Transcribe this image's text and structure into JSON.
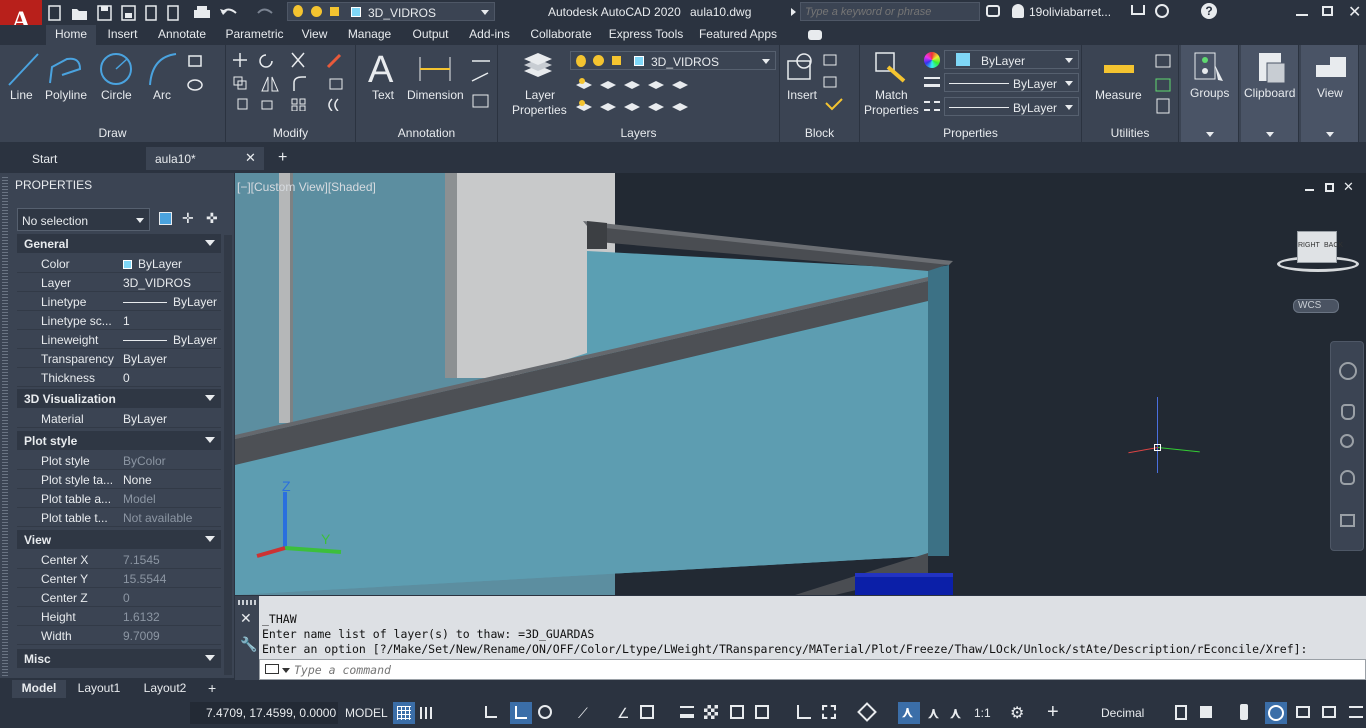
{
  "qat": {
    "app_title": "Autodesk AutoCAD 2020",
    "file_name": "aula10.dwg",
    "layer_current": "3D_VIDROS",
    "search_placeholder": "Type a keyword or phrase",
    "user": "19oliviabarret..."
  },
  "ribbon_tabs": [
    "Home",
    "Insert",
    "Annotate",
    "Parametric",
    "View",
    "Manage",
    "Output",
    "Add-ins",
    "Collaborate",
    "Express Tools",
    "Featured Apps"
  ],
  "ribbon": {
    "draw": {
      "title": "Draw",
      "line": "Line",
      "polyline": "Polyline",
      "circle": "Circle",
      "arc": "Arc"
    },
    "modify": {
      "title": "Modify"
    },
    "annotation": {
      "title": "Annotation",
      "text": "Text",
      "dimension": "Dimension"
    },
    "layers": {
      "title": "Layers",
      "layer_properties_1": "Layer",
      "layer_properties_2": "Properties",
      "current": "3D_VIDROS"
    },
    "block": {
      "title": "Block",
      "insert": "Insert"
    },
    "properties": {
      "title": "Properties",
      "match_1": "Match",
      "match_2": "Properties",
      "color": "ByLayer",
      "linetype": "ByLayer",
      "lineweight": "ByLayer"
    },
    "utilities": {
      "title": "Utilities",
      "measure": "Measure"
    },
    "groups": "Groups",
    "clipboard": "Clipboard",
    "view": "View"
  },
  "doc_tabs": {
    "start": "Start",
    "current": "aula10*"
  },
  "properties": {
    "title": "PROPERTIES",
    "selection": "No selection",
    "sections": {
      "general": "General",
      "viz3d": "3D Visualization",
      "plot": "Plot style",
      "view": "View",
      "misc": "Misc"
    },
    "general": [
      {
        "k": "Color",
        "v": "ByLayer"
      },
      {
        "k": "Layer",
        "v": "3D_VIDROS"
      },
      {
        "k": "Linetype",
        "v": "ByLayer"
      },
      {
        "k": "Linetype sc...",
        "v": "1"
      },
      {
        "k": "Lineweight",
        "v": "ByLayer"
      },
      {
        "k": "Transparency",
        "v": "ByLayer"
      },
      {
        "k": "Thickness",
        "v": "0"
      }
    ],
    "viz3d": [
      {
        "k": "Material",
        "v": "ByLayer"
      }
    ],
    "plot": [
      {
        "k": "Plot style",
        "v": "ByColor"
      },
      {
        "k": "Plot style ta...",
        "v": "None"
      },
      {
        "k": "Plot table a...",
        "v": "Model"
      },
      {
        "k": "Plot table t...",
        "v": "Not available"
      }
    ],
    "view": [
      {
        "k": "Center X",
        "v": "7.1545"
      },
      {
        "k": "Center Y",
        "v": "15.5544"
      },
      {
        "k": "Center Z",
        "v": "0"
      },
      {
        "k": "Height",
        "v": "1.6132"
      },
      {
        "k": "Width",
        "v": "9.7009"
      }
    ]
  },
  "viewport": {
    "label": "[−][Custom View][Shaded]",
    "wcs": "WCS",
    "cube_right": "RIGHT",
    "cube_back": "BACK",
    "axis_z": "Z",
    "axis_y": "Y"
  },
  "command": {
    "lines": [
      "_THAW",
      "Enter name list of layer(s) to thaw: =3D_GUARDAS",
      "Enter an option [?/Make/Set/New/Rename/ON/OFF/Color/Ltype/LWeight/TRansparency/MATerial/Plot/Freeze/Thaw/LOck/Unlock/stAte/Description/rEconcile/Xref]:"
    ],
    "placeholder": "Type a command"
  },
  "layout_tabs": [
    "Model",
    "Layout1",
    "Layout2"
  ],
  "status": {
    "coords": "7.4709, 17.4599, 0.0000",
    "model": "MODEL",
    "scale": "1:1",
    "units": "Decimal"
  },
  "colors": {
    "accent": "#4aa3df",
    "glass": "#5b9fb3",
    "wall": "#c8c9ca",
    "beam": "#4a4d52"
  }
}
